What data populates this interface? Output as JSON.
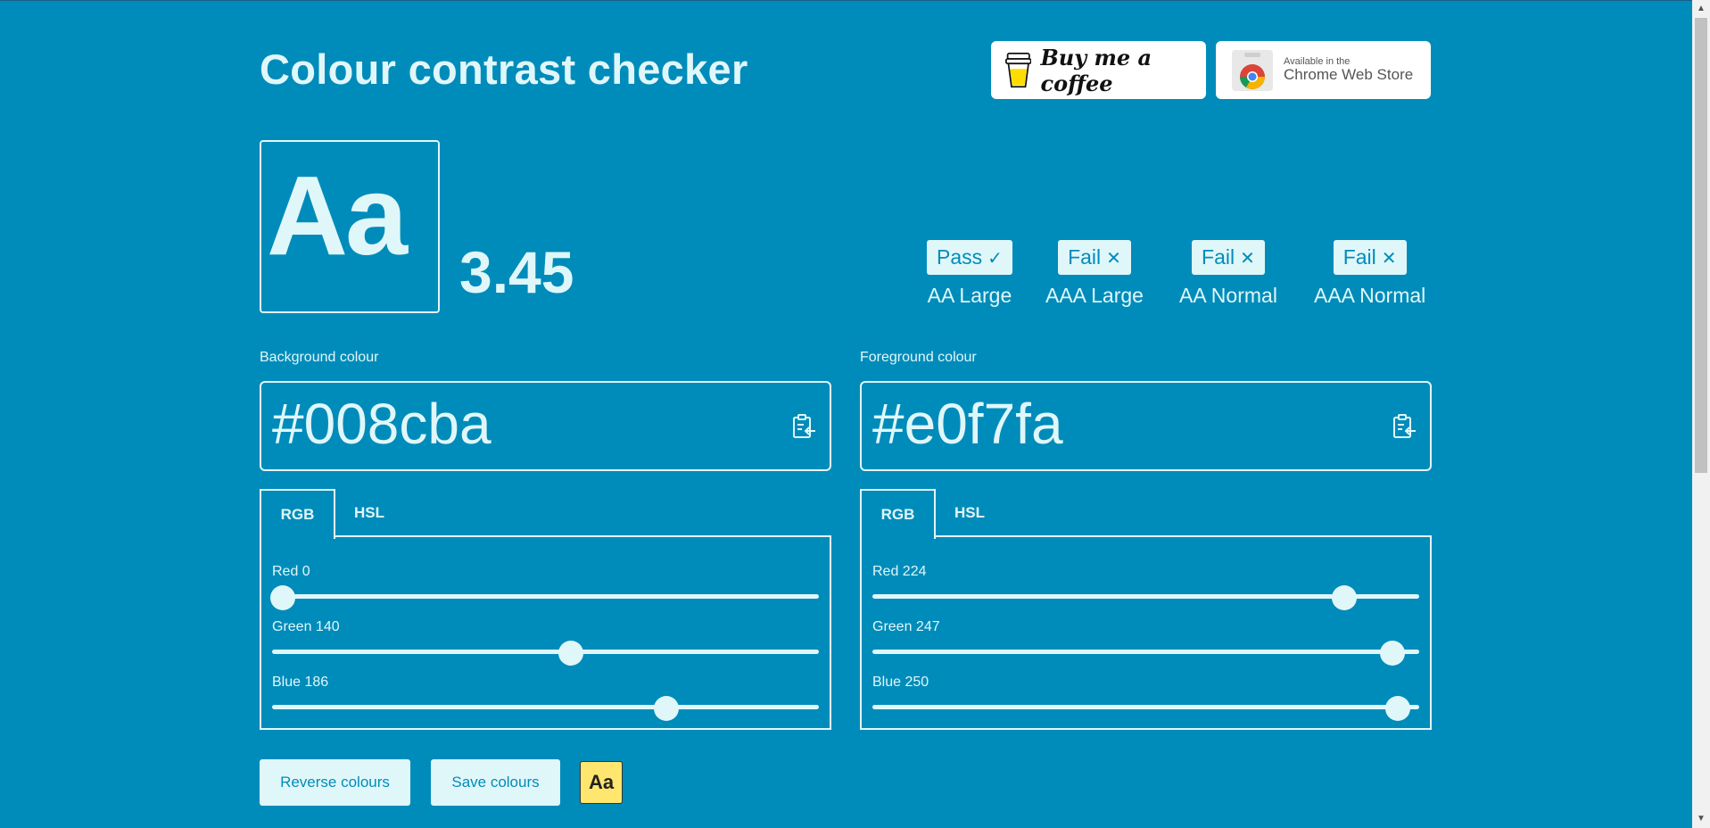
{
  "page": {
    "title": "Colour contrast checker"
  },
  "badges": {
    "coffee_label": "Buy me a coffee",
    "chrome_small": "Available in the",
    "chrome_big": "Chrome Web Store"
  },
  "preview": {
    "sample": "Aa"
  },
  "contrast_ratio": "3.45",
  "levels": [
    {
      "status": "Pass",
      "mark": "✓",
      "label": "AA Large"
    },
    {
      "status": "Fail",
      "mark": "✕",
      "label": "AAA Large"
    },
    {
      "status": "Fail",
      "mark": "✕",
      "label": "AA Normal"
    },
    {
      "status": "Fail",
      "mark": "✕",
      "label": "AAA Normal"
    }
  ],
  "background": {
    "label": "Background colour",
    "hex": "#008cba",
    "tabs": [
      "RGB",
      "HSL"
    ],
    "active_tab": "RGB",
    "sliders": [
      {
        "label": "Red 0",
        "value": 0,
        "max": 255
      },
      {
        "label": "Green 140",
        "value": 140,
        "max": 255
      },
      {
        "label": "Blue 186",
        "value": 186,
        "max": 255
      }
    ]
  },
  "foreground": {
    "label": "Foreground colour",
    "hex": "#e0f7fa",
    "tabs": [
      "RGB",
      "HSL"
    ],
    "active_tab": "RGB",
    "sliders": [
      {
        "label": "Red 224",
        "value": 224,
        "max": 255
      },
      {
        "label": "Green 247",
        "value": 247,
        "max": 255
      },
      {
        "label": "Blue 250",
        "value": 250,
        "max": 255
      }
    ]
  },
  "actions": {
    "reverse": "Reverse colours",
    "save": "Save colours",
    "aa": "Aa"
  },
  "colors": {
    "background": "#008cba",
    "foreground": "#e0f7fa",
    "aa_button": "#ffe66e"
  },
  "icons": [
    "coffee-cup-icon",
    "chrome-logo-icon",
    "clipboard-paste-icon",
    "check-icon",
    "cross-icon",
    "scroll-up-arrow-icon",
    "scroll-down-arrow-icon"
  ]
}
